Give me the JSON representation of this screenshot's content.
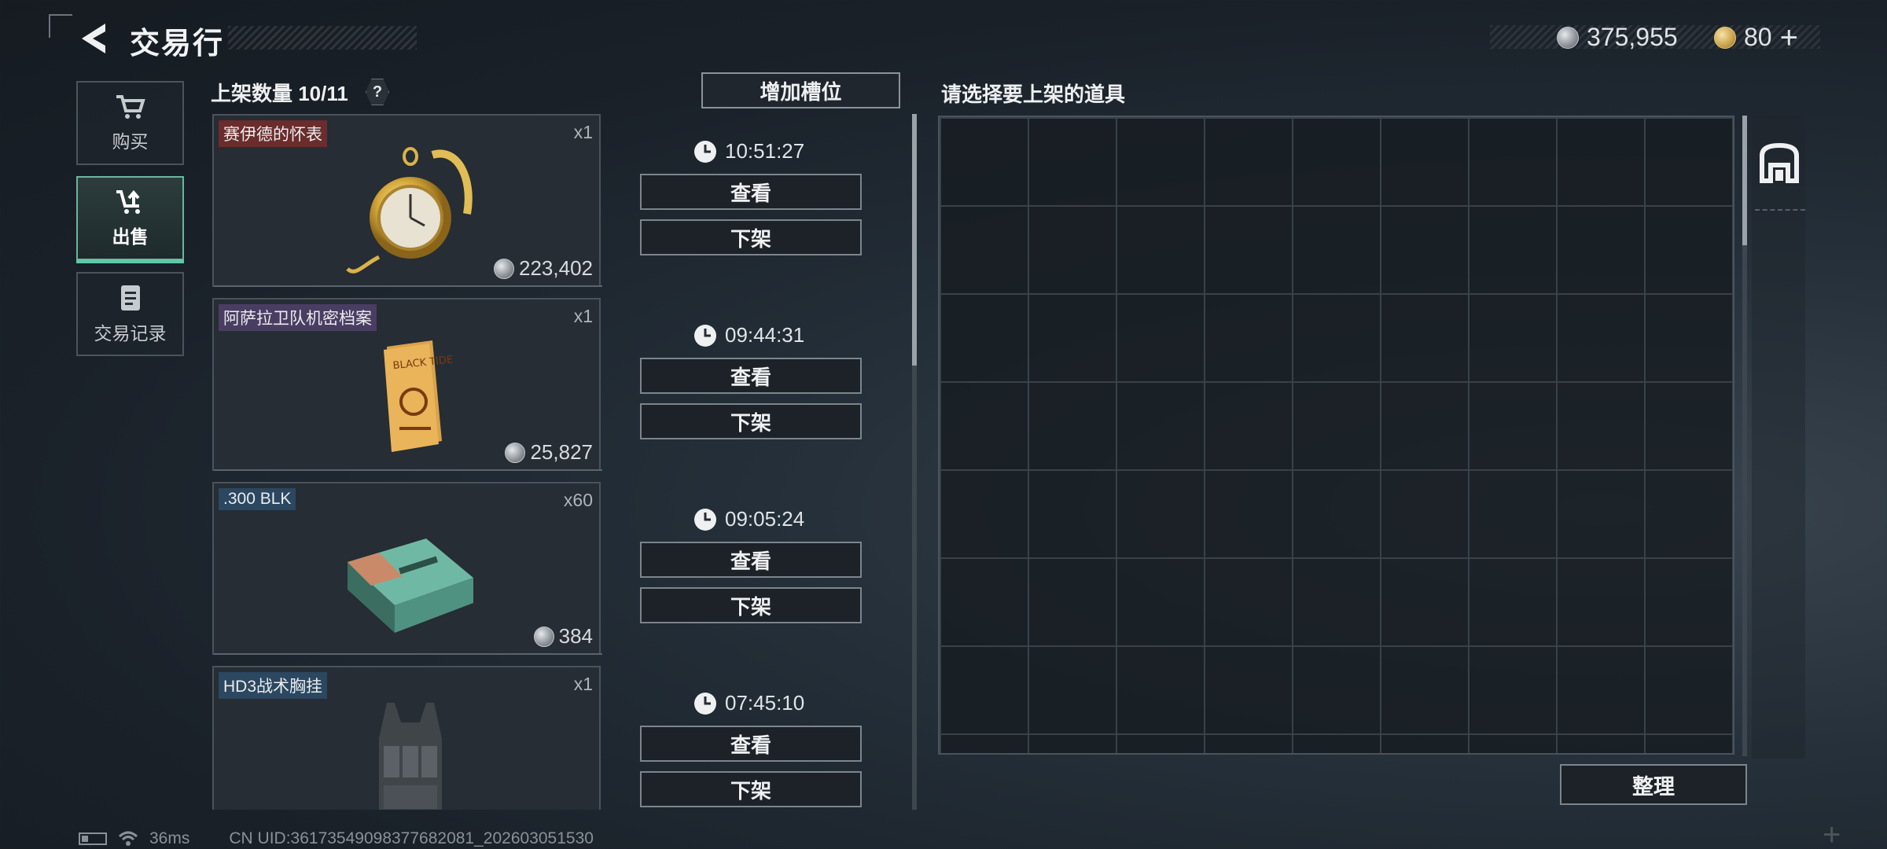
{
  "header": {
    "title": "交易行"
  },
  "currency": [
    {
      "icon": "silver-coin-icon",
      "value": "375,955"
    },
    {
      "icon": "gold-coin-icon",
      "value": "80"
    }
  ],
  "currency_plus": "+",
  "nav": [
    {
      "label": "购买",
      "icon": "cart-icon"
    },
    {
      "label": "出售",
      "icon": "sell-cart-icon",
      "active": true
    },
    {
      "label": "交易记录",
      "icon": "record-icon"
    }
  ],
  "listings_header": {
    "count_label": "上架数量 10/11",
    "help": "?",
    "add_slot": "增加槽位"
  },
  "listings": [
    {
      "name": "赛伊德的怀表",
      "qty": "x1",
      "price": "223,402",
      "timer": "10:51:27",
      "view": "查看",
      "delist": "下架",
      "tag": "red",
      "art": "pocket-watch"
    },
    {
      "name": "阿萨拉卫队机密档案",
      "qty": "x1",
      "price": "25,827",
      "timer": "09:44:31",
      "view": "查看",
      "delist": "下架",
      "tag": "purple",
      "art": "document"
    },
    {
      "name": ".300 BLK",
      "qty": "x60",
      "price": "384",
      "timer": "09:05:24",
      "view": "查看",
      "delist": "下架",
      "tag": "blue",
      "art": "ammo-box"
    },
    {
      "name": "HD3战术胸挂",
      "qty": "x1",
      "price": "",
      "timer": "07:45:10",
      "view": "查看",
      "delist": "下架",
      "tag": "blue",
      "art": "chest-rig"
    }
  ],
  "art_text": {
    "document": "BLACK TIDE"
  },
  "inventory": {
    "title": "请选择要上架的道具",
    "sort": "整理"
  },
  "status": {
    "ping": "36ms",
    "uid": "CN UID:3617354909837768208​1_202603051530"
  },
  "colors": {
    "accent": "#5fc7a6",
    "tag_red": "#6a2c2c",
    "tag_purple": "#4a3d62",
    "tag_blue": "#2c4760"
  }
}
